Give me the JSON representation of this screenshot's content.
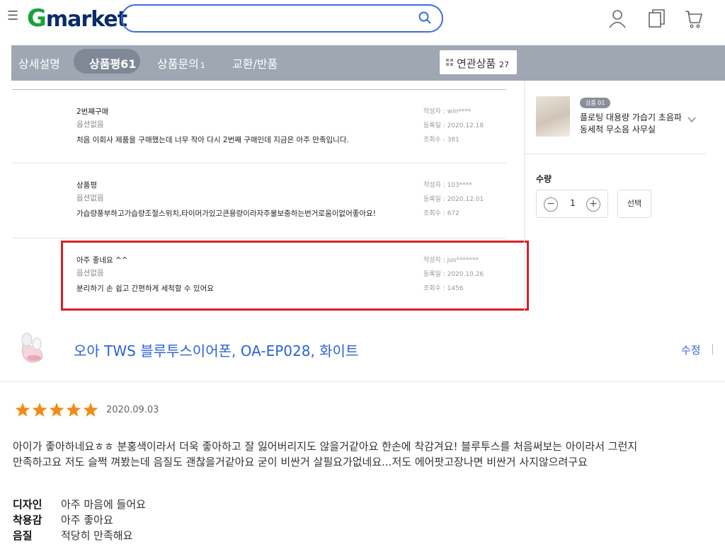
{
  "header": {
    "menu_icon": "hamburger-icon",
    "logo_g": "G",
    "logo_rest": "market",
    "search_placeholder": "",
    "icons": [
      "search-icon",
      "user-icon",
      "recent-items-icon",
      "cart-icon"
    ]
  },
  "tabs": [
    {
      "label": "상세설명",
      "count": ""
    },
    {
      "label": "상품평",
      "count": "61"
    },
    {
      "label": "상품문의",
      "count": "1"
    },
    {
      "label": "교환/반품",
      "count": ""
    }
  ],
  "related": {
    "label": "연관상품",
    "count": "27"
  },
  "reviews": [
    {
      "title": "2번째구매",
      "option": "옵션없음",
      "body": "처음 이회사 제품을 구매했는데 너무 작아 다시 2번째 구매인데 지금은 아주 만족입니다.",
      "author": "작성자 : win****",
      "date": "등록일 : 2020.12.18",
      "views": "조회수 : 381"
    },
    {
      "title": "상품평",
      "option": "옵션없음",
      "body": "가습량풍부하고가습량조절스위치,타이머가있고큰용량이라자주물보충하는번거로움이없어좋아요!",
      "author": "작성자 : 103****",
      "date": "등록일 : 2020.12.01",
      "views": "조회수 : 672"
    },
    {
      "title": "아주 좋네요 ^^",
      "option": "옵션없음",
      "body": "분리하기 손 쉽고 간편하게 세척할 수 있어요",
      "author": "작성자 : jus*******",
      "date": "등록일 : 2020.10.26",
      "views": "조회수 : 1456"
    }
  ],
  "side_product": {
    "badge": "상품 01",
    "name": "플로팅 대용량 가습기 초음파 동세척 무소음 사무실",
    "qty_label": "수량",
    "qty_value": "1",
    "minus": "−",
    "plus": "+",
    "select_label": "선택"
  },
  "product_review": {
    "product_name": "오아 TWS 블루투스이어폰, OA-EP028, 화이트",
    "edit_label": "수정",
    "rating": 5,
    "date": "2020.09.03",
    "text_line1": "아이가 좋아하네요ㅎㅎ 분홍색이라서 더욱 좋아하고 잘 잃어버리지도 않을거같아요 한손에 착감겨요! 블루투스를 처음써보는 아이라서 그런지",
    "text_line2": "만족하고요 저도 슬쩍 껴봤는데 음질도 괜찮을거같아요 굳이 비싼거 살필요가없네요...저도 에어팟고장나면 비싼거 사지않으려구요",
    "attributes": [
      {
        "key": "디자인",
        "value": "아주 마음에 들어요"
      },
      {
        "key": "착용감",
        "value": "아주 좋아요"
      },
      {
        "key": "음질",
        "value": "적당히 만족해요"
      }
    ]
  },
  "colors": {
    "brand_green": "#1aa23a",
    "brand_navy": "#0a2b6b",
    "search_border": "#3a6de0",
    "tabbar_bg": "#9fa7b3",
    "highlight_red": "#d42026",
    "link_blue": "#2c63d6",
    "star_orange": "#f28a14"
  }
}
